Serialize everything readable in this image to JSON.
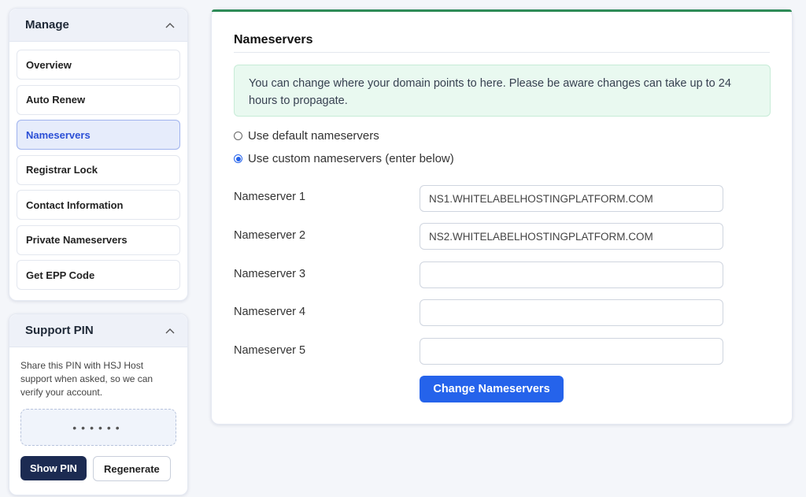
{
  "manage": {
    "title": "Manage",
    "items": [
      {
        "label": "Overview"
      },
      {
        "label": "Auto Renew"
      },
      {
        "label": "Nameservers"
      },
      {
        "label": "Registrar Lock"
      },
      {
        "label": "Contact Information"
      },
      {
        "label": "Private Nameservers"
      },
      {
        "label": "Get EPP Code"
      }
    ],
    "active_item": "Nameservers"
  },
  "support_pin": {
    "title": "Support PIN",
    "description": "Share this PIN with HSJ Host support when asked, so we can verify your account.",
    "masked_pin": "••••••",
    "show_label": "Show PIN",
    "regenerate_label": "Regenerate"
  },
  "nameservers": {
    "title": "Nameservers",
    "notice": "You can change where your domain points to here. Please be aware changes can take up to 24 hours to propagate.",
    "options": {
      "default_label": "Use default nameservers",
      "custom_label": "Use custom nameservers (enter below)",
      "selected": "custom"
    },
    "fields": [
      {
        "label": "Nameserver 1",
        "value": "NS1.WHITELABELHOSTINGPLATFORM.COM"
      },
      {
        "label": "Nameserver 2",
        "value": "NS2.WHITELABELHOSTINGPLATFORM.COM"
      },
      {
        "label": "Nameserver 3",
        "value": ""
      },
      {
        "label": "Nameserver 4",
        "value": ""
      },
      {
        "label": "Nameserver 5",
        "value": ""
      }
    ],
    "submit_label": "Change Nameservers"
  },
  "colors": {
    "accent": "#2563eb",
    "success_bar": "#2e8b57",
    "dark_button": "#1c2b52"
  },
  "icons": {
    "collapse": "chevron-up-icon"
  }
}
